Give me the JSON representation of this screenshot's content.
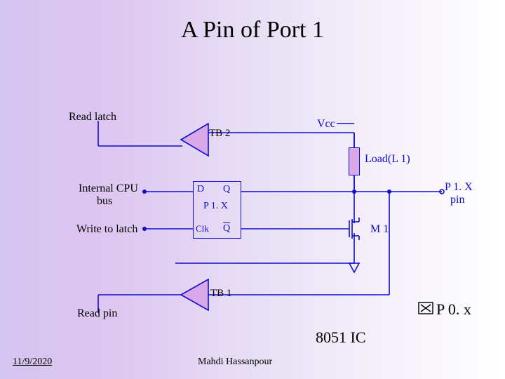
{
  "title": "A Pin of Port 1",
  "labels": {
    "read_latch": "Read latch",
    "tb2": "TB 2",
    "vcc": "Vcc",
    "load": "Load(L 1)",
    "internal_cpu_bus_1": "Internal CPU",
    "internal_cpu_bus_2": "bus",
    "d": "D",
    "q": "Q",
    "p1x_latch": "P 1. X",
    "clk": "Clk",
    "qbar": "Q",
    "write_to_latch": "Write to latch",
    "m1": "M 1",
    "p1x_pin_1": "P 1. X",
    "p1x_pin_2": "pin",
    "tb1": "TB 1",
    "read_pin": "Read pin",
    "p0x": "P 0. x",
    "ic": "8051 IC"
  },
  "footer": {
    "date": "11/9/2020",
    "author": "Mahdi Hassanpour"
  }
}
